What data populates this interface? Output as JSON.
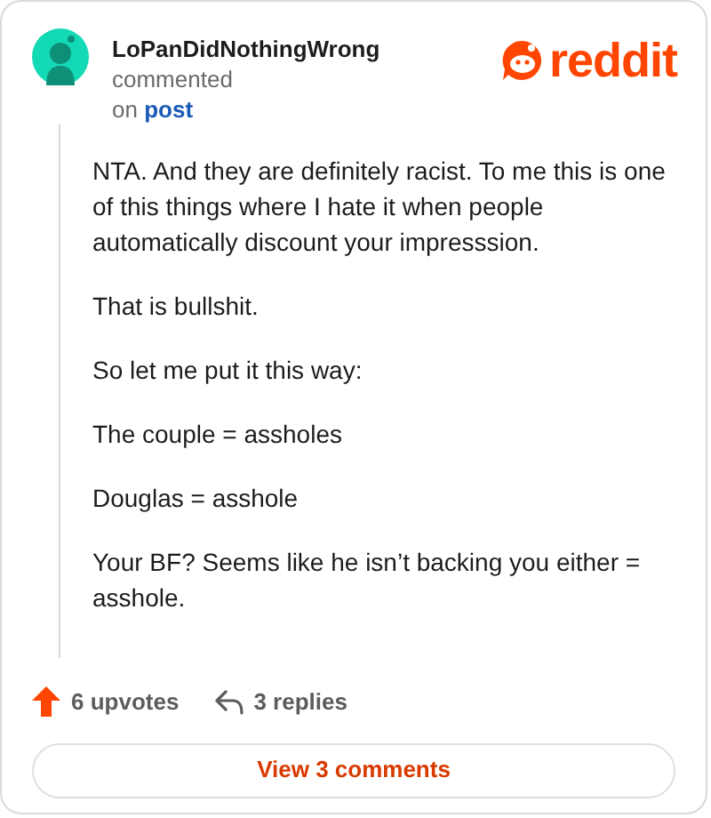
{
  "comment": {
    "author": "LoPanDidNothingWrong",
    "action": "commented",
    "preposition": "on",
    "target": "post",
    "paragraphs": [
      "NTA. And they are definitely racist. To me this is one of this things where I hate it when people automatically discount your impresssion.",
      "That is bullshit.",
      "So let me put it this way:",
      "The couple = assholes",
      "Douglas = asshole",
      "Your BF? Seems like he isn’t backing you either = asshole."
    ]
  },
  "logo": {
    "wordmark": "reddit"
  },
  "stats": {
    "upvotes": "6 upvotes",
    "upvoted": true,
    "replies": "3 replies"
  },
  "button": {
    "label": "View 3 comments"
  }
}
